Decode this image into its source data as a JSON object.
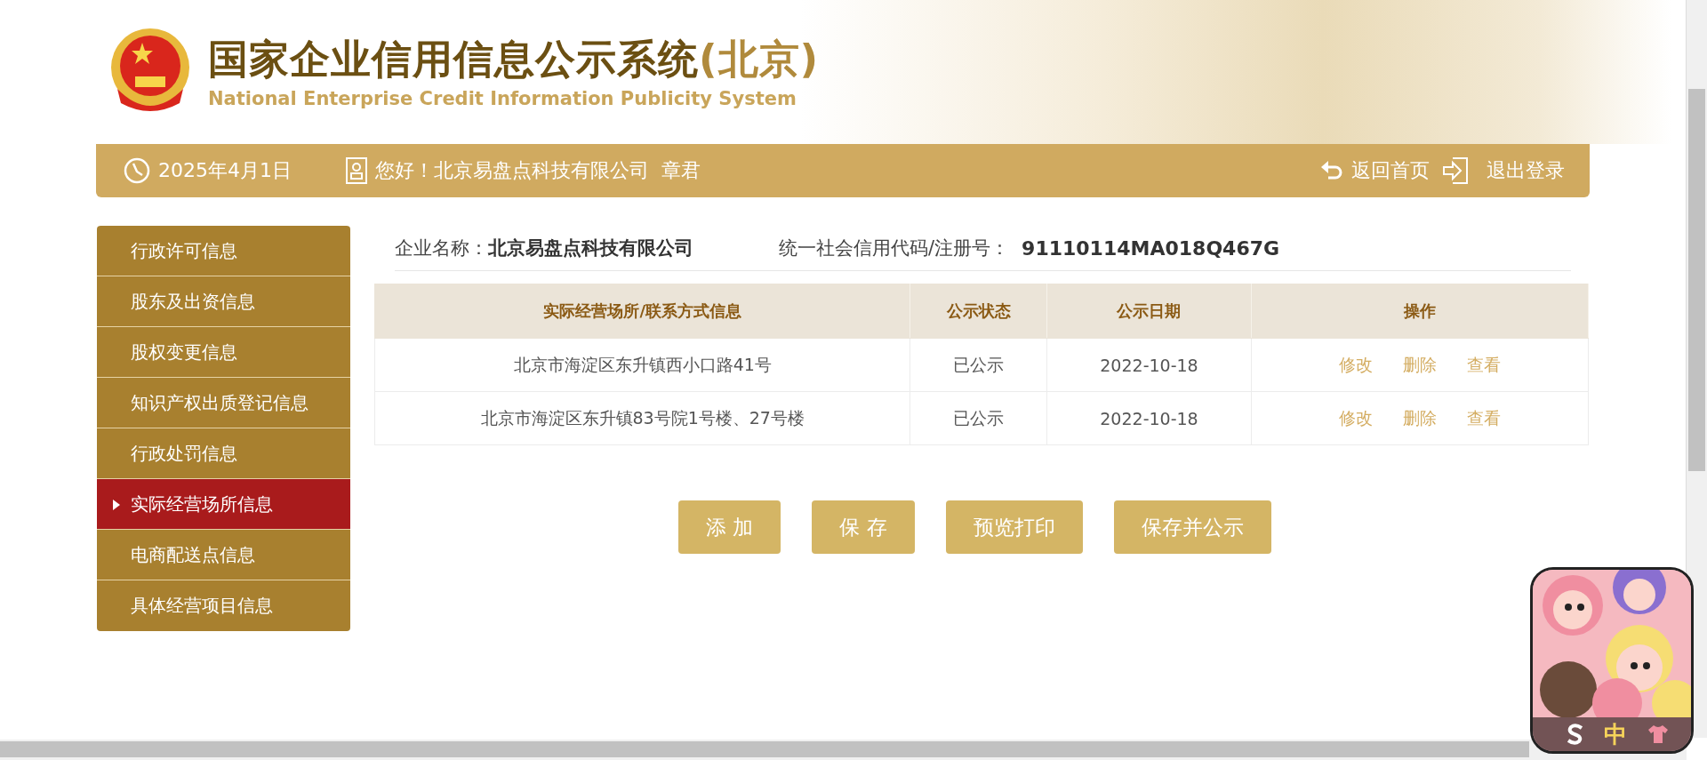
{
  "header": {
    "title": "国家企业信用信息公示系统",
    "region": "(北京)",
    "subtitle": "National Enterprise Credit Information Publicity System"
  },
  "top_bar": {
    "date": "2025年4月1日",
    "greeting": "您好！北京易盘点科技有限公司  章君",
    "links": [
      {
        "label": "返回首页",
        "kind": "home"
      },
      {
        "label": "退出登录",
        "kind": "logout"
      }
    ]
  },
  "sidebar": {
    "items": [
      {
        "label": "行政许可信息",
        "selected": false
      },
      {
        "label": "股东及出资信息",
        "selected": false
      },
      {
        "label": "股权变更信息",
        "selected": false
      },
      {
        "label": "知识产权出质登记信息",
        "selected": false
      },
      {
        "label": "行政处罚信息",
        "selected": false
      },
      {
        "label": "实际经营场所信息",
        "selected": true
      },
      {
        "label": "电商配送点信息",
        "selected": false
      },
      {
        "label": "具体经营项目信息",
        "selected": false
      }
    ]
  },
  "company": {
    "name_label": "企业名称：",
    "name": "北京易盘点科技有限公司",
    "code_label": "统一社会信用代码/注册号：",
    "code": "91110114MA018Q467G"
  },
  "table": {
    "columns": [
      "实际经营场所/联系方式信息",
      "公示状态",
      "公示日期",
      "操作"
    ],
    "rows": [
      {
        "address": "北京市海淀区东升镇西小口路41号",
        "status": "已公示",
        "date": "2022-10-18",
        "actions": [
          "修改",
          "删除",
          "查看"
        ]
      },
      {
        "address": "北京市海淀区东升镇83号院1号楼、27号楼",
        "status": "已公示",
        "date": "2022-10-18",
        "actions": [
          "修改",
          "删除",
          "查看"
        ]
      }
    ]
  },
  "buttons": [
    "添 加",
    "保 存",
    "预览打印",
    "保存并公示"
  ],
  "ime_widget": {
    "mode": "中"
  }
}
